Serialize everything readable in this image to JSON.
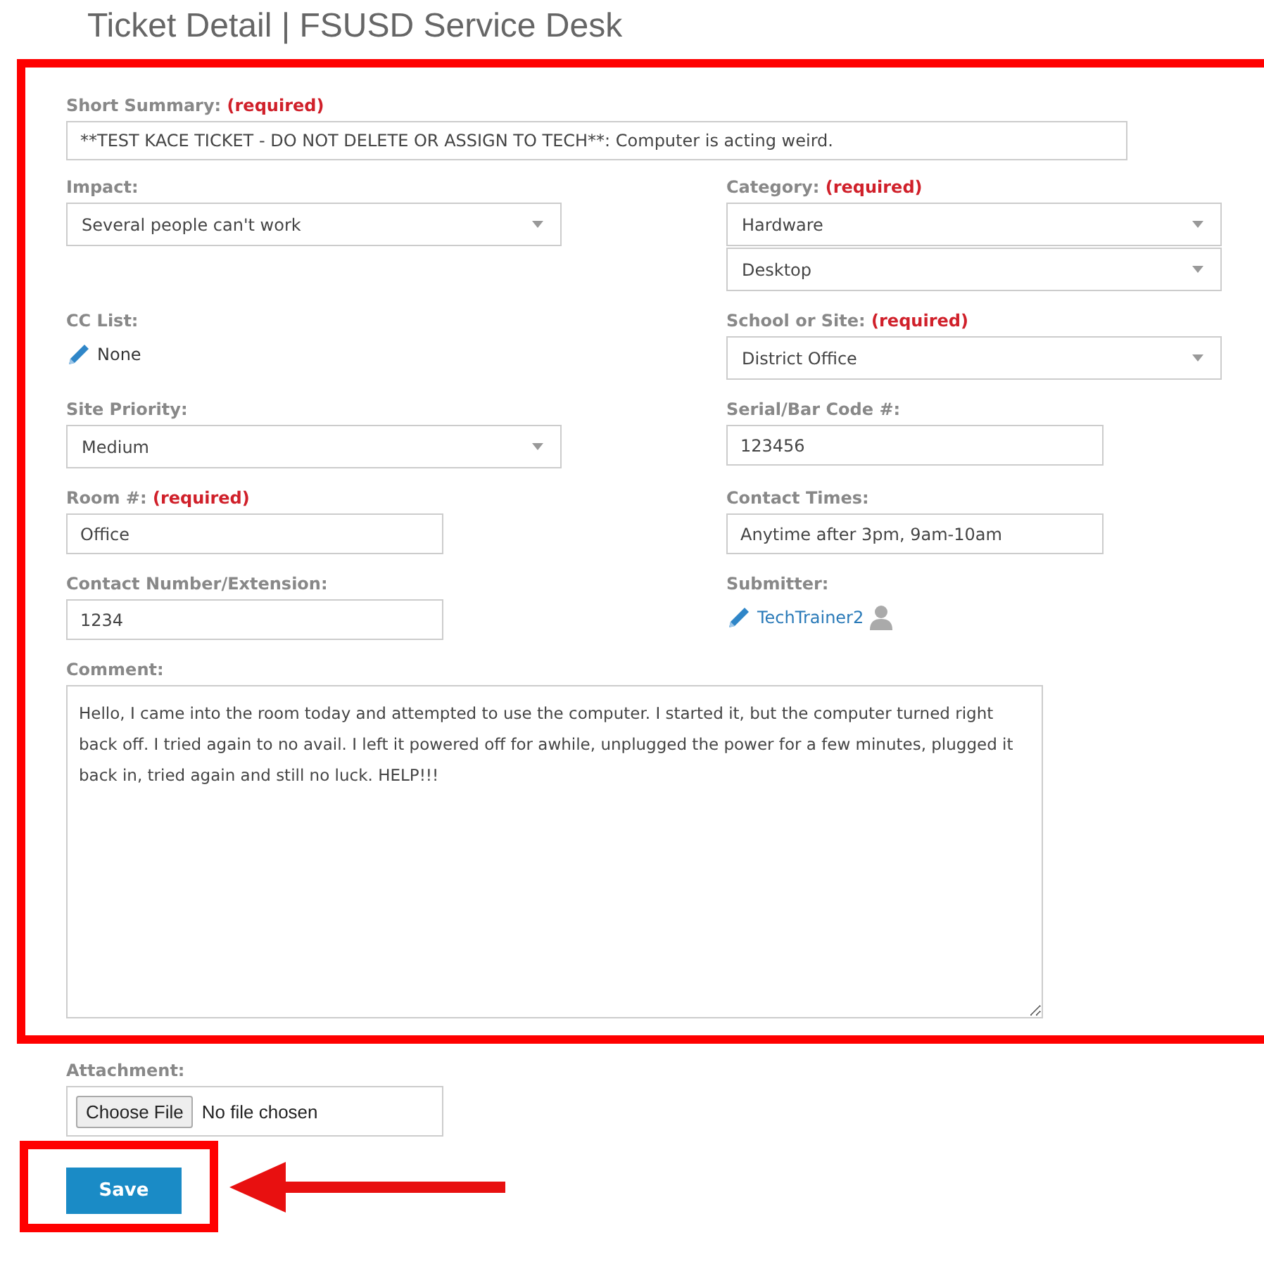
{
  "page_title": "Ticket Detail | FSUSD Service Desk",
  "summary": {
    "label": "Short Summary:",
    "required": "(required)",
    "value": "**TEST KACE TICKET - DO NOT DELETE OR ASSIGN TO TECH**: Computer is acting weird."
  },
  "rows": [
    {
      "left": {
        "kind": "select",
        "label": "Impact:",
        "values": [
          "Several people can't work"
        ]
      },
      "right": {
        "kind": "select",
        "label": "Category:",
        "required": "(required)",
        "values": [
          "Hardware",
          "Desktop"
        ]
      }
    },
    {
      "left": {
        "kind": "link",
        "label": "CC List:",
        "value": "None"
      },
      "right": {
        "kind": "select",
        "label": "School or Site:",
        "required": "(required)",
        "values": [
          "District Office"
        ]
      }
    },
    {
      "left": {
        "kind": "select",
        "label": "Site Priority:",
        "values": [
          "Medium"
        ]
      },
      "right": {
        "kind": "text",
        "label": "Serial/Bar Code #:",
        "value": "123456"
      }
    },
    {
      "left": {
        "kind": "text",
        "label": "Room #:",
        "required": "(required)",
        "value": "Office"
      },
      "right": {
        "kind": "text",
        "label": "Contact Times:",
        "value": "Anytime after 3pm, 9am-10am"
      }
    },
    {
      "left": {
        "kind": "text",
        "label": "Contact Number/Extension:",
        "value": "1234"
      },
      "right": {
        "kind": "user",
        "label": "Submitter:",
        "value": "TechTrainer2"
      }
    }
  ],
  "comment": {
    "label": "Comment:",
    "value": "Hello, I came into the room today and attempted to use the computer. I started it, but the computer turned right back off. I tried again to no avail. I left it powered off for awhile, unplugged the power for a few minutes, plugged it back in, tried again and still no luck. HELP!!!"
  },
  "attachment": {
    "label": "Attachment:",
    "button": "Choose File",
    "status": "No file chosen"
  },
  "save_button": "Save"
}
